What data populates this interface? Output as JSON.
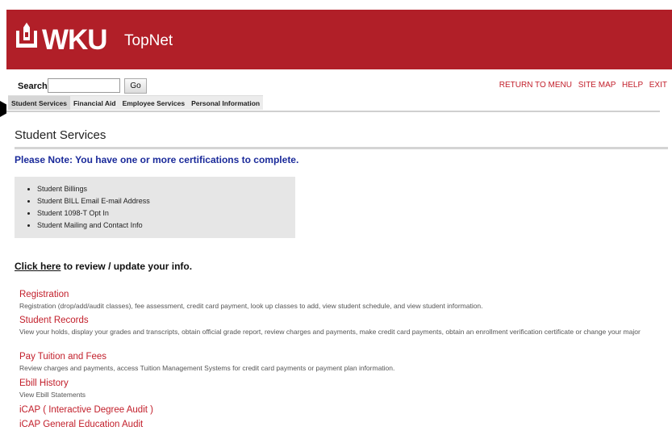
{
  "header": {
    "logo": "WKU",
    "app_name": "TopNet"
  },
  "search": {
    "label": "Search",
    "placeholder": "",
    "go_label": "Go"
  },
  "top_links": [
    "RETURN TO MENU",
    "SITE MAP",
    "HELP",
    "EXIT"
  ],
  "tabs": [
    {
      "label": "Student Services",
      "active": true
    },
    {
      "label": "Financial Aid"
    },
    {
      "label": "Employee Services"
    },
    {
      "label": "Personal Information"
    }
  ],
  "page": {
    "title": "Student Services",
    "note": "Please Note: You have one or more certifications to complete.",
    "certifications": [
      "Student Billings",
      "Student BILL Email E-mail Address",
      "Student 1098-T Opt In",
      "Student Mailing and Contact Info"
    ],
    "review_link": "Click here",
    "review_rest": " to review / update your info."
  },
  "menu": [
    {
      "title": "Registration",
      "desc": "Registration (drop/add/audit classes), fee assessment, credit card payment, look up classes to add, view student schedule, and view student information."
    },
    {
      "title": "Student Records",
      "desc": "View your holds, display your grades and transcripts, obtain official grade report, review charges and payments, make credit card payments, obtain an enrollment verification certificate or change your major"
    },
    {
      "title": "Pay Tuition and Fees",
      "desc": "Review charges and payments, access Tuition Management Systems for credit card payments or payment plan information."
    },
    {
      "title": "Ebill History",
      "desc": "View Ebill Statements"
    },
    {
      "title": "iCAP ( Interactive Degree Audit )",
      "desc": ""
    },
    {
      "title": "iCAP General Education Audit",
      "desc": ""
    }
  ],
  "colors": {
    "brand": "#b11f28",
    "link": "#c21e2a",
    "note": "#1a2a9a"
  }
}
